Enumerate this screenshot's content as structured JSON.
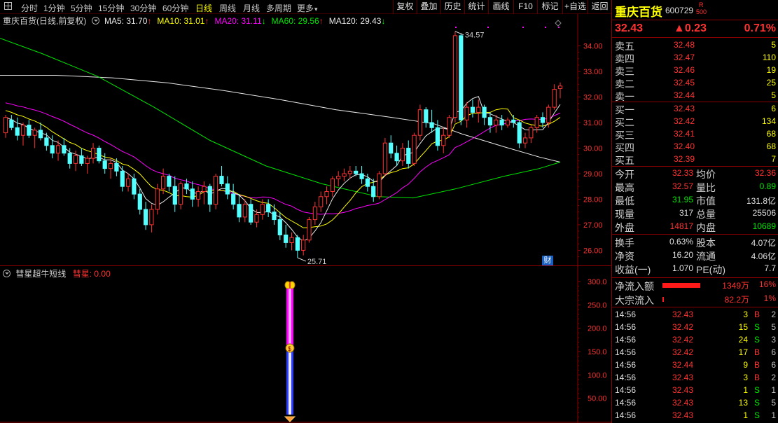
{
  "toolbar": {
    "periods": [
      "分时",
      "1分钟",
      "5分钟",
      "15分钟",
      "30分钟",
      "60分钟",
      "日线",
      "周线",
      "月线",
      "多周期",
      "更多"
    ],
    "active_period": "日线",
    "buttons": [
      "复权",
      "叠加",
      "历史",
      "统计",
      "画线",
      "F10",
      "标记",
      "+自选",
      "返回"
    ]
  },
  "main_chart": {
    "title": "重庆百货(日线,前复权)",
    "ma": [
      {
        "name": "MA5",
        "value": "31.70",
        "arrow": "↑",
        "color": "#e8e8e8"
      },
      {
        "name": "MA10",
        "value": "31.01",
        "arrow": "↑",
        "color": "#ffff00"
      },
      {
        "name": "MA20",
        "value": "31.11",
        "arrow": "↓",
        "color": "#ff00ff"
      },
      {
        "name": "MA60",
        "value": "29.56",
        "arrow": "↑",
        "color": "#00e600"
      },
      {
        "name": "MA120",
        "value": "29.43",
        "arrow": "↓",
        "color": "#e8e8e8"
      }
    ],
    "high_label": "34.57",
    "low_label": "25.71",
    "fin_badge": "财"
  },
  "indicator": {
    "name": "彗星超牛短线",
    "series_name": "彗星",
    "series_value": "0.00",
    "axis_labels": [
      "300.0",
      "250.0",
      "200.0",
      "150.0",
      "100.0",
      "50.00"
    ]
  },
  "chart_data": {
    "type": "candlestick",
    "y_ticks": [
      "34.00",
      "33.00",
      "32.00",
      "31.00",
      "30.00",
      "29.00",
      "28.00",
      "27.00",
      "26.00"
    ],
    "ylim": [
      25.6,
      34.7
    ],
    "candles": [
      {
        "o": 30.6,
        "h": 31.3,
        "l": 30.4,
        "c": 31.2
      },
      {
        "o": 31.1,
        "h": 31.3,
        "l": 30.7,
        "c": 30.8
      },
      {
        "o": 30.8,
        "h": 31.2,
        "l": 30.3,
        "c": 30.5
      },
      {
        "o": 30.5,
        "h": 31.0,
        "l": 30.1,
        "c": 30.9
      },
      {
        "o": 30.9,
        "h": 31.1,
        "l": 30.4,
        "c": 30.5
      },
      {
        "o": 30.5,
        "h": 30.8,
        "l": 30.0,
        "c": 30.7
      },
      {
        "o": 30.7,
        "h": 31.0,
        "l": 30.3,
        "c": 30.4
      },
      {
        "o": 30.4,
        "h": 30.6,
        "l": 29.9,
        "c": 30.1
      },
      {
        "o": 30.1,
        "h": 30.5,
        "l": 29.6,
        "c": 29.8
      },
      {
        "o": 29.8,
        "h": 30.3,
        "l": 29.5,
        "c": 30.1
      },
      {
        "o": 30.1,
        "h": 30.4,
        "l": 29.7,
        "c": 29.8
      },
      {
        "o": 29.8,
        "h": 30.0,
        "l": 29.2,
        "c": 29.4
      },
      {
        "o": 29.4,
        "h": 29.9,
        "l": 29.1,
        "c": 29.7
      },
      {
        "o": 29.7,
        "h": 30.0,
        "l": 29.3,
        "c": 29.4
      },
      {
        "o": 29.4,
        "h": 29.7,
        "l": 29.0,
        "c": 29.6
      },
      {
        "o": 29.6,
        "h": 30.2,
        "l": 29.4,
        "c": 30.0
      },
      {
        "o": 30.0,
        "h": 30.1,
        "l": 29.4,
        "c": 29.5
      },
      {
        "o": 29.5,
        "h": 29.8,
        "l": 29.0,
        "c": 29.2
      },
      {
        "o": 29.2,
        "h": 29.6,
        "l": 28.8,
        "c": 29.4
      },
      {
        "o": 29.4,
        "h": 29.6,
        "l": 28.9,
        "c": 29.1
      },
      {
        "o": 29.1,
        "h": 29.3,
        "l": 28.3,
        "c": 28.5
      },
      {
        "o": 28.5,
        "h": 29.0,
        "l": 28.3,
        "c": 28.8
      },
      {
        "o": 28.8,
        "h": 29.0,
        "l": 28.0,
        "c": 28.2
      },
      {
        "o": 28.2,
        "h": 28.4,
        "l": 27.4,
        "c": 27.6
      },
      {
        "o": 27.6,
        "h": 27.9,
        "l": 26.8,
        "c": 27.0
      },
      {
        "o": 27.0,
        "h": 27.8,
        "l": 26.7,
        "c": 27.6
      },
      {
        "o": 27.6,
        "h": 28.6,
        "l": 27.4,
        "c": 28.4
      },
      {
        "o": 28.4,
        "h": 29.2,
        "l": 28.2,
        "c": 28.9
      },
      {
        "o": 28.9,
        "h": 29.0,
        "l": 28.3,
        "c": 28.5
      },
      {
        "o": 28.5,
        "h": 28.9,
        "l": 27.5,
        "c": 27.8
      },
      {
        "o": 27.8,
        "h": 28.7,
        "l": 27.6,
        "c": 28.6
      },
      {
        "o": 28.6,
        "h": 28.8,
        "l": 28.2,
        "c": 28.4
      },
      {
        "o": 28.4,
        "h": 28.7,
        "l": 27.7,
        "c": 28.0
      },
      {
        "o": 28.0,
        "h": 28.5,
        "l": 27.7,
        "c": 28.3
      },
      {
        "o": 28.3,
        "h": 28.7,
        "l": 27.8,
        "c": 28.5
      },
      {
        "o": 28.5,
        "h": 28.6,
        "l": 27.5,
        "c": 27.8
      },
      {
        "o": 27.8,
        "h": 29.0,
        "l": 27.6,
        "c": 28.9
      },
      {
        "o": 28.9,
        "h": 29.3,
        "l": 28.5,
        "c": 28.6
      },
      {
        "o": 28.6,
        "h": 28.9,
        "l": 28.0,
        "c": 28.2
      },
      {
        "o": 28.2,
        "h": 28.6,
        "l": 27.6,
        "c": 27.8
      },
      {
        "o": 27.8,
        "h": 28.2,
        "l": 27.1,
        "c": 27.3
      },
      {
        "o": 27.3,
        "h": 28.0,
        "l": 27.1,
        "c": 27.8
      },
      {
        "o": 27.8,
        "h": 28.0,
        "l": 27.0,
        "c": 27.1
      },
      {
        "o": 27.1,
        "h": 27.6,
        "l": 26.9,
        "c": 27.4
      },
      {
        "o": 27.4,
        "h": 28.0,
        "l": 27.2,
        "c": 27.8
      },
      {
        "o": 27.8,
        "h": 28.0,
        "l": 27.3,
        "c": 27.5
      },
      {
        "o": 27.5,
        "h": 27.8,
        "l": 27.0,
        "c": 27.2
      },
      {
        "o": 27.2,
        "h": 27.5,
        "l": 26.4,
        "c": 26.6
      },
      {
        "o": 26.6,
        "h": 27.0,
        "l": 26.1,
        "c": 26.3
      },
      {
        "o": 26.3,
        "h": 26.7,
        "l": 26.0,
        "c": 26.5
      },
      {
        "o": 26.5,
        "h": 26.6,
        "l": 25.71,
        "c": 26.0
      },
      {
        "o": 26.0,
        "h": 26.6,
        "l": 25.8,
        "c": 26.4
      },
      {
        "o": 26.4,
        "h": 27.3,
        "l": 26.3,
        "c": 27.2
      },
      {
        "o": 27.2,
        "h": 27.9,
        "l": 27.0,
        "c": 27.7
      },
      {
        "o": 27.7,
        "h": 28.3,
        "l": 27.5,
        "c": 28.1
      },
      {
        "o": 28.1,
        "h": 28.5,
        "l": 27.8,
        "c": 28.3
      },
      {
        "o": 28.3,
        "h": 28.9,
        "l": 28.1,
        "c": 28.8
      },
      {
        "o": 28.8,
        "h": 29.1,
        "l": 28.5,
        "c": 28.9
      },
      {
        "o": 28.9,
        "h": 29.2,
        "l": 28.7,
        "c": 29.0
      },
      {
        "o": 29.0,
        "h": 29.3,
        "l": 28.8,
        "c": 29.1
      },
      {
        "o": 29.1,
        "h": 29.3,
        "l": 28.9,
        "c": 29.0
      },
      {
        "o": 29.0,
        "h": 29.3,
        "l": 28.6,
        "c": 28.8
      },
      {
        "o": 28.8,
        "h": 29.0,
        "l": 28.3,
        "c": 28.5
      },
      {
        "o": 28.5,
        "h": 28.8,
        "l": 27.9,
        "c": 28.1
      },
      {
        "o": 28.1,
        "h": 29.1,
        "l": 28.0,
        "c": 29.0
      },
      {
        "o": 29.0,
        "h": 30.4,
        "l": 28.9,
        "c": 30.2
      },
      {
        "o": 30.2,
        "h": 30.5,
        "l": 29.6,
        "c": 29.8
      },
      {
        "o": 29.8,
        "h": 30.1,
        "l": 29.3,
        "c": 29.5
      },
      {
        "o": 29.5,
        "h": 30.2,
        "l": 29.3,
        "c": 30.0
      },
      {
        "o": 30.0,
        "h": 30.3,
        "l": 29.2,
        "c": 29.4
      },
      {
        "o": 29.4,
        "h": 30.6,
        "l": 29.3,
        "c": 30.5
      },
      {
        "o": 30.5,
        "h": 31.7,
        "l": 30.3,
        "c": 31.5
      },
      {
        "o": 31.5,
        "h": 31.6,
        "l": 30.8,
        "c": 31.0
      },
      {
        "o": 31.0,
        "h": 31.5,
        "l": 30.6,
        "c": 30.8
      },
      {
        "o": 30.8,
        "h": 31.1,
        "l": 29.9,
        "c": 30.1
      },
      {
        "o": 30.1,
        "h": 30.8,
        "l": 29.8,
        "c": 30.5
      },
      {
        "o": 30.5,
        "h": 31.3,
        "l": 30.4,
        "c": 31.2
      },
      {
        "o": 31.2,
        "h": 34.57,
        "l": 31.0,
        "c": 34.4
      },
      {
        "o": 34.4,
        "h": 34.5,
        "l": 30.9,
        "c": 31.1
      },
      {
        "o": 31.1,
        "h": 31.8,
        "l": 30.8,
        "c": 31.6
      },
      {
        "o": 31.6,
        "h": 31.9,
        "l": 31.2,
        "c": 31.4
      },
      {
        "o": 31.4,
        "h": 31.9,
        "l": 31.0,
        "c": 31.6
      },
      {
        "o": 31.6,
        "h": 31.7,
        "l": 30.9,
        "c": 31.2
      },
      {
        "o": 31.2,
        "h": 31.4,
        "l": 30.6,
        "c": 30.9
      },
      {
        "o": 30.9,
        "h": 31.3,
        "l": 30.6,
        "c": 31.1
      },
      {
        "o": 31.1,
        "h": 31.3,
        "l": 30.7,
        "c": 30.9
      },
      {
        "o": 30.9,
        "h": 31.2,
        "l": 30.8,
        "c": 31.1
      },
      {
        "o": 31.1,
        "h": 31.3,
        "l": 30.8,
        "c": 31.0
      },
      {
        "o": 31.0,
        "h": 31.1,
        "l": 30.0,
        "c": 30.2
      },
      {
        "o": 30.2,
        "h": 30.6,
        "l": 30.0,
        "c": 30.4
      },
      {
        "o": 30.4,
        "h": 30.9,
        "l": 30.2,
        "c": 30.8
      },
      {
        "o": 30.8,
        "h": 31.3,
        "l": 30.6,
        "c": 31.2
      },
      {
        "o": 31.2,
        "h": 31.4,
        "l": 30.8,
        "c": 31.0
      },
      {
        "o": 31.0,
        "h": 31.7,
        "l": 30.8,
        "c": 31.6
      },
      {
        "o": 31.6,
        "h": 32.5,
        "l": 31.5,
        "c": 32.3
      },
      {
        "o": 32.33,
        "h": 32.57,
        "l": 31.95,
        "c": 32.43
      }
    ]
  },
  "quote": {
    "name": "重庆百货",
    "code": "600729",
    "badge_top": "R",
    "badge_bottom": "500",
    "price": "32.43",
    "change": "▲0.23",
    "change_pct": "0.71%"
  },
  "orderbook": {
    "sell": [
      {
        "label": "卖五",
        "price": "32.48",
        "vol": "5"
      },
      {
        "label": "卖四",
        "price": "32.47",
        "vol": "110"
      },
      {
        "label": "卖三",
        "price": "32.46",
        "vol": "19"
      },
      {
        "label": "卖二",
        "price": "32.45",
        "vol": "25"
      },
      {
        "label": "卖一",
        "price": "32.44",
        "vol": "5"
      }
    ],
    "buy": [
      {
        "label": "买一",
        "price": "32.43",
        "vol": "6"
      },
      {
        "label": "买二",
        "price": "32.42",
        "vol": "134"
      },
      {
        "label": "买三",
        "price": "32.41",
        "vol": "68"
      },
      {
        "label": "买四",
        "price": "32.40",
        "vol": "68"
      },
      {
        "label": "买五",
        "price": "32.39",
        "vol": "7"
      }
    ]
  },
  "stats": {
    "rows": [
      [
        {
          "l": "今开",
          "v": "32.33",
          "c": "red"
        },
        {
          "l": "均价",
          "v": "32.36",
          "c": "red"
        }
      ],
      [
        {
          "l": "最高",
          "v": "32.57",
          "c": "red"
        },
        {
          "l": "量比",
          "v": "0.89",
          "c": "green"
        }
      ],
      [
        {
          "l": "最低",
          "v": "31.95",
          "c": "green"
        },
        {
          "l": "市值",
          "v": "131.8亿",
          "c": "white"
        }
      ],
      [
        {
          "l": "现量",
          "v": "317",
          "c": "white"
        },
        {
          "l": "总量",
          "v": "25506",
          "c": "white"
        }
      ],
      [
        {
          "l": "外盘",
          "v": "14817",
          "c": "red"
        },
        {
          "l": "内盘",
          "v": "10689",
          "c": "green"
        }
      ]
    ],
    "rows2": [
      [
        {
          "l": "换手",
          "v": "0.63%",
          "c": "white"
        },
        {
          "l": "股本",
          "v": "4.07亿",
          "c": "white"
        }
      ],
      [
        {
          "l": "净资",
          "v": "16.20",
          "c": "white"
        },
        {
          "l": "流通",
          "v": "4.06亿",
          "c": "white"
        }
      ],
      [
        {
          "l": "收益(一)",
          "v": "1.070",
          "c": "white"
        },
        {
          "l": "PE(动)",
          "v": "7.7",
          "c": "white"
        }
      ]
    ]
  },
  "flow": {
    "net_inflow_label": "净流入额",
    "net_inflow_value": "1349万",
    "net_inflow_pct": "16%",
    "net_inflow_bar": 0.68,
    "block_label": "大宗流入",
    "block_value": "82.2万",
    "block_pct": "1%",
    "block_bar": 0.03
  },
  "ticks": [
    {
      "time": "14:56",
      "price": "32.43",
      "vol": "3",
      "side": "B",
      "cnt": "2"
    },
    {
      "time": "14:56",
      "price": "32.42",
      "vol": "15",
      "side": "S",
      "cnt": "5"
    },
    {
      "time": "14:56",
      "price": "32.42",
      "vol": "24",
      "side": "S",
      "cnt": "3"
    },
    {
      "time": "14:56",
      "price": "32.42",
      "vol": "17",
      "side": "B",
      "cnt": "6"
    },
    {
      "time": "14:56",
      "price": "32.44",
      "vol": "9",
      "side": "B",
      "cnt": "6"
    },
    {
      "time": "14:56",
      "price": "32.43",
      "vol": "3",
      "side": "B",
      "cnt": "2"
    },
    {
      "time": "14:56",
      "price": "32.43",
      "vol": "1",
      "side": "S",
      "cnt": "1"
    },
    {
      "time": "14:56",
      "price": "32.43",
      "vol": "13",
      "side": "S",
      "cnt": "5"
    },
    {
      "time": "14:56",
      "price": "32.43",
      "vol": "1",
      "side": "S",
      "cnt": "1"
    }
  ],
  "colors": {
    "up": "#ff3232",
    "down": "#54ffff",
    "grid": "#8b0000"
  }
}
